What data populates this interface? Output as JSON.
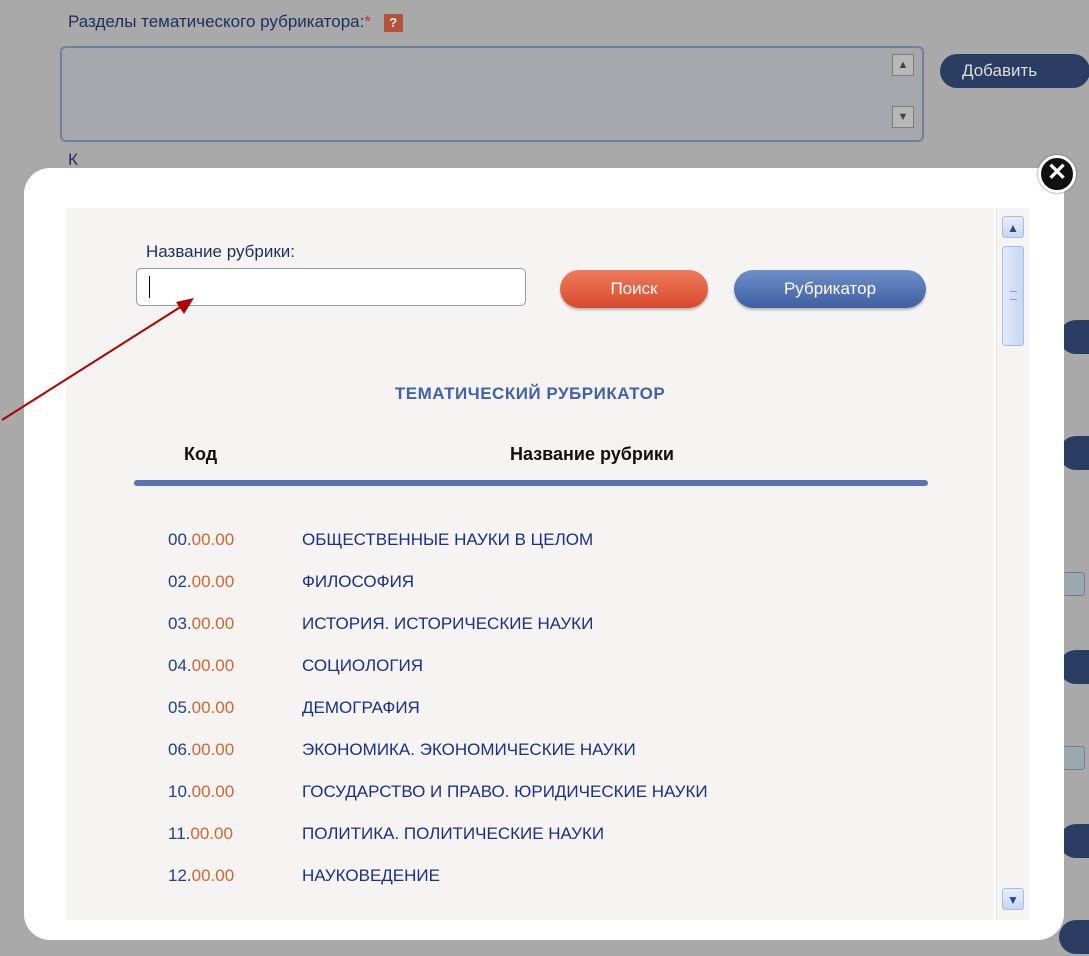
{
  "background": {
    "sections_label": "Разделы тематического рубрикатора:",
    "required_mark": "*",
    "help_label": "?",
    "add_button": "Добавить",
    "second_label_partial": "К",
    "scroll_up": "▲",
    "scroll_down": "▼"
  },
  "modal": {
    "close_label": "✕",
    "search": {
      "label": "Название рубрики:",
      "value": "",
      "search_button": "Поиск",
      "rubricator_button": "Рубрикатор"
    },
    "table": {
      "title": "ТЕМАТИЧЕСКИЙ РУБРИКАТОР",
      "col_code": "Код",
      "col_name": "Название рубрики",
      "rows": [
        {
          "code_main": "00.",
          "code_sub": "00.00",
          "name": "ОБЩЕСТВЕННЫЕ НАУКИ В ЦЕЛОМ"
        },
        {
          "code_main": "02.",
          "code_sub": "00.00",
          "name": "ФИЛОСОФИЯ"
        },
        {
          "code_main": "03.",
          "code_sub": "00.00",
          "name": "ИСТОРИЯ. ИСТОРИЧЕСКИЕ НАУКИ"
        },
        {
          "code_main": "04.",
          "code_sub": "00.00",
          "name": "СОЦИОЛОГИЯ"
        },
        {
          "code_main": "05.",
          "code_sub": "00.00",
          "name": "ДЕМОГРАФИЯ"
        },
        {
          "code_main": "06.",
          "code_sub": "00.00",
          "name": "ЭКОНОМИКА. ЭКОНОМИЧЕСКИЕ НАУКИ"
        },
        {
          "code_main": "10.",
          "code_sub": "00.00",
          "name": "ГОСУДАРСТВО И ПРАВО. ЮРИДИЧЕСКИЕ НАУКИ"
        },
        {
          "code_main": "11.",
          "code_sub": "00.00",
          "name": "ПОЛИТИКА. ПОЛИТИЧЕСКИЕ НАУКИ"
        },
        {
          "code_main": "12.",
          "code_sub": "00.00",
          "name": "НАУКОВЕДЕНИЕ"
        }
      ]
    },
    "scrollbar": {
      "up": "▲",
      "down": "▼"
    }
  },
  "colors": {
    "accent_blue": "#4261a6",
    "code_orange": "#d2662f",
    "search_button": "#e05a3a",
    "annotation_arrow": "#b00000"
  }
}
